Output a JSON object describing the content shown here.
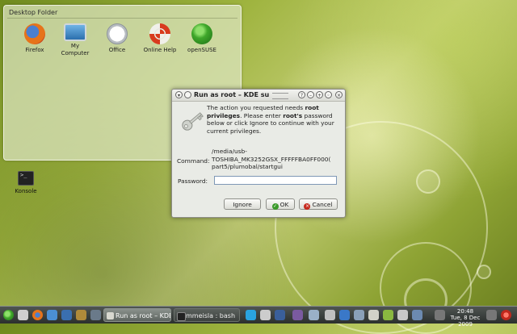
{
  "desktop_folder": {
    "title": "Desktop Folder",
    "icons": [
      {
        "label": "Firefox",
        "icon": "firefox-icon"
      },
      {
        "label": "My\nComputer",
        "icon": "computer-icon"
      },
      {
        "label": "Office",
        "icon": "office-icon"
      },
      {
        "label": "Online Help",
        "icon": "help-lifebuoy-icon"
      },
      {
        "label": "openSUSE",
        "icon": "opensuse-icon"
      }
    ]
  },
  "desktop_icons": [
    {
      "label": "Konsole",
      "icon": "terminal-icon"
    }
  ],
  "dialog": {
    "title": "Run as root – KDE su",
    "message_pre": "The action you requested needs ",
    "message_bold1": "root privileges",
    "message_mid": ". Please enter ",
    "message_bold2": "root's",
    "message_post": " password below or click Ignore to continue with your current privileges.",
    "command_label": "Command:",
    "command_value": "/media/usb-\nTOSHIBA_MK3252GSX_FFFFFBA0FF000(\npart5/plumobal/startgui",
    "password_label": "Password:",
    "password_value": "",
    "buttons": {
      "ignore": "Ignore",
      "ok": "OK",
      "cancel": "Cancel"
    }
  },
  "taskbar": {
    "tasks": [
      {
        "label": "Run as root – KDE",
        "active": true
      },
      {
        "label": "mmeisla : bash",
        "active": false
      }
    ],
    "clock": {
      "time": "20:48",
      "date": "Tue, 8 Dec 2009"
    }
  },
  "colors": {
    "wallpaper": "#9fb43f",
    "taskbar": "#2b2f2d",
    "dialog_bg": "#e9ebe6",
    "ok_green": "#3a9a2a",
    "cancel_red": "#c62a1e"
  }
}
